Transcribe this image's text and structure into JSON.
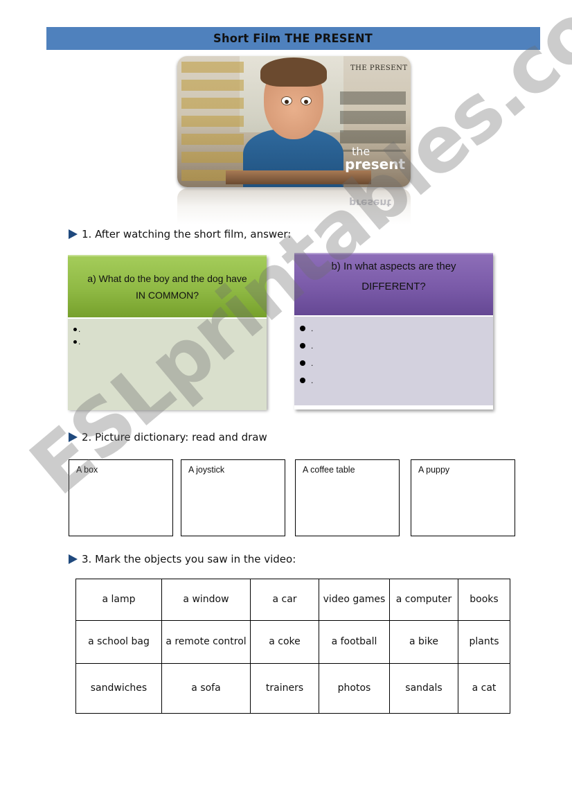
{
  "title": "Short Film THE PRESENT",
  "poster": {
    "caption_title": "THE PRESENT",
    "logo_the": "the",
    "logo_present": "present",
    "reflection_text": "present"
  },
  "section1": {
    "heading": "1. After watching the short film, answer:",
    "question_a": {
      "line1": "a) What do the boy and the dog have",
      "line2": "IN COMMON?",
      "bullets": [
        ".",
        "."
      ]
    },
    "question_b": {
      "line1": "b) In what aspects  are they",
      "line2": "DIFFERENT?",
      "bullets": [
        ".",
        ".",
        ".",
        "."
      ]
    },
    "colors": {
      "green_header": "#8fb944",
      "green_body": "#d9dfcc",
      "purple_header": "#7a5aa8",
      "purple_body": "#d3d1de"
    }
  },
  "section2": {
    "heading": "2. Picture dictionary: read and draw",
    "boxes": [
      "A box",
      "A joystick",
      "A coffee table",
      "A puppy"
    ]
  },
  "section3": {
    "heading": "3. Mark the objects you saw in the video:",
    "rows": [
      [
        "a lamp",
        "a window",
        "a car",
        "video games",
        "a computer",
        "books"
      ],
      [
        "a school bag",
        "a remote control",
        "a coke",
        "a football",
        "a bike",
        "plants"
      ],
      [
        "sandwiches",
        "a sofa",
        "trainers",
        "photos",
        "sandals",
        "a cat"
      ]
    ]
  },
  "watermark": "ESLprintables.com",
  "accent_colors": {
    "title_bar": "#4f81bd",
    "arrow": "#1f497d"
  }
}
